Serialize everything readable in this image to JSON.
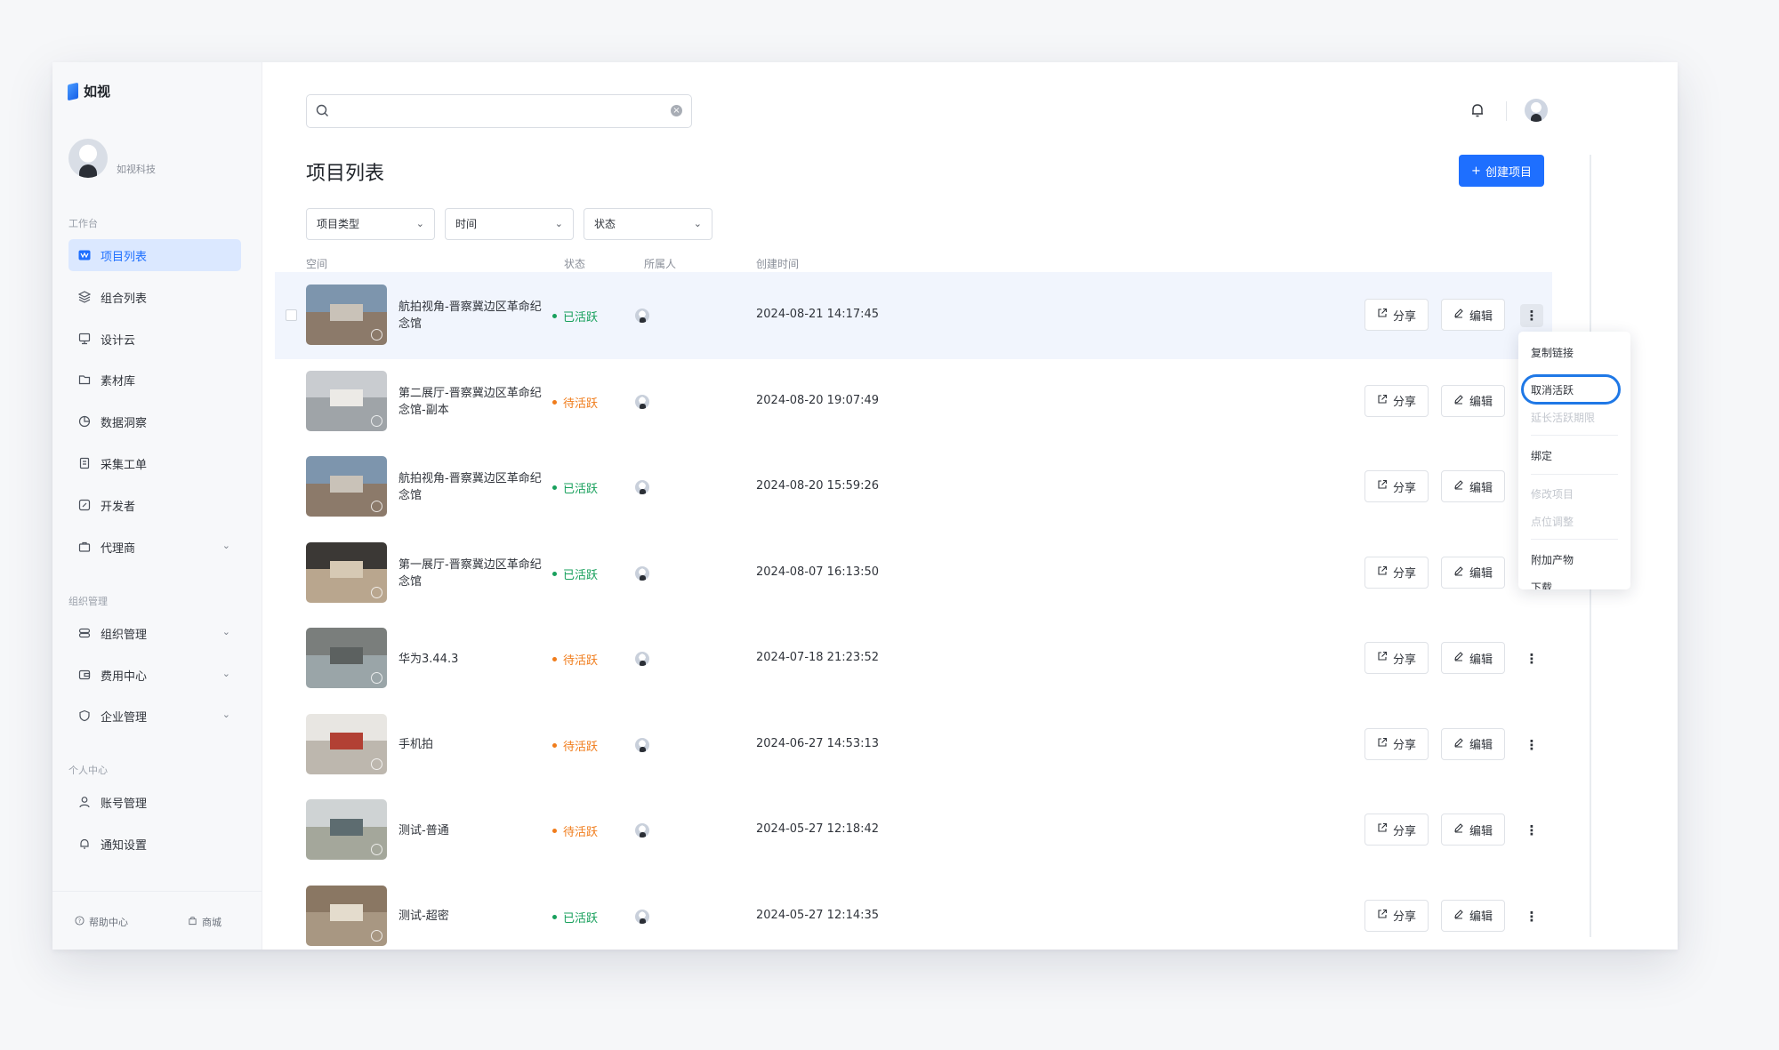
{
  "brand": {
    "name": "如视"
  },
  "profile": {
    "org": "如视科技"
  },
  "sidebar": {
    "section_workbench": "工作台",
    "section_org": "组织管理",
    "section_personal": "个人中心",
    "items": [
      {
        "label": "项目列表",
        "icon": "project-list-icon"
      },
      {
        "label": "组合列表",
        "icon": "layers-icon"
      },
      {
        "label": "设计云",
        "icon": "monitor-icon"
      },
      {
        "label": "素材库",
        "icon": "folder-icon"
      },
      {
        "label": "数据洞察",
        "icon": "chart-icon"
      },
      {
        "label": "采集工单",
        "icon": "ticket-icon"
      },
      {
        "label": "开发者",
        "icon": "code-icon"
      },
      {
        "label": "代理商",
        "icon": "briefcase-icon"
      },
      {
        "label": "组织管理",
        "icon": "org-icon"
      },
      {
        "label": "费用中心",
        "icon": "wallet-icon"
      },
      {
        "label": "企业管理",
        "icon": "shield-icon"
      },
      {
        "label": "账号管理",
        "icon": "user-icon"
      },
      {
        "label": "通知设置",
        "icon": "bell-icon"
      }
    ],
    "footer": {
      "help": "帮助中心",
      "store": "商城"
    }
  },
  "search": {
    "placeholder": ""
  },
  "page": {
    "title": "项目列表",
    "create_button": "创建项目"
  },
  "filters": {
    "type": "项目类型",
    "time": "时间",
    "status": "状态"
  },
  "columns": {
    "space": "空间",
    "status": "状态",
    "owner": "所属人",
    "created": "创建时间"
  },
  "actions": {
    "share": "分享",
    "edit": "编辑"
  },
  "colors": {
    "accent": "#1e6fff",
    "active": "#18a05c",
    "pending": "#f07c1b"
  },
  "rows": [
    {
      "name": "航拍视角-晋察冀边区革命纪念馆",
      "status": "已活跃",
      "state": "active",
      "time": "2024-08-21 14:17:45"
    },
    {
      "name": "第二展厅-晋察冀边区革命纪念馆-副本",
      "status": "待活跃",
      "state": "pending",
      "time": "2024-08-20 19:07:49"
    },
    {
      "name": "航拍视角-晋察冀边区革命纪念馆",
      "status": "已活跃",
      "state": "active",
      "time": "2024-08-20 15:59:26"
    },
    {
      "name": "第一展厅-晋察冀边区革命纪念馆",
      "status": "已活跃",
      "state": "active",
      "time": "2024-08-07 16:13:50"
    },
    {
      "name": "华为3.44.3",
      "status": "待活跃",
      "state": "pending",
      "time": "2024-07-18 21:23:52"
    },
    {
      "name": "手机拍",
      "status": "待活跃",
      "state": "pending",
      "time": "2024-06-27 14:53:13"
    },
    {
      "name": "测试-普通",
      "status": "待活跃",
      "state": "pending",
      "time": "2024-05-27 12:18:42"
    },
    {
      "name": "测试-超密",
      "status": "已活跃",
      "state": "active",
      "time": "2024-05-27 12:14:35"
    }
  ],
  "menu": {
    "copy_link": "复制链接",
    "deactivate": "取消活跃",
    "extend": "延长活跃期限",
    "bind": "绑定",
    "modify": "修改项目",
    "adjust": "点位调整",
    "addon": "附加产物",
    "download": "下载"
  }
}
